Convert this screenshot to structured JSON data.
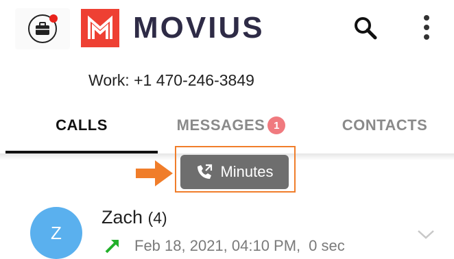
{
  "header": {
    "brand": "MOVIUS",
    "work_button_icon": "briefcase-icon",
    "search_icon": "search-icon",
    "menu_icon": "more-vert-icon",
    "logo_colors": {
      "mark": "#ee4033",
      "text": "#2e2b46"
    },
    "notification_dot_color": "#e8221b"
  },
  "work_line": {
    "label": "Work:",
    "number": "+1 470-246-3849"
  },
  "tabs": [
    {
      "label": "CALLS",
      "active": true
    },
    {
      "label": "MESSAGES",
      "badge": "1",
      "active": false
    },
    {
      "label": "CONTACTS",
      "active": false
    }
  ],
  "minutes": {
    "label": "Minutes",
    "icon": "phone-transfer-icon",
    "highlight_color": "#f07d2a",
    "arrow_icon": "arrow-right-icon"
  },
  "calls": [
    {
      "initial": "Z",
      "name": "Zach",
      "count": "(4)",
      "direction_icon": "outgoing-call-arrow-icon",
      "datetime": "Feb 18, 2021, 04:10 PM,",
      "duration": "0 sec",
      "avatar_color": "#5ab0ee"
    }
  ]
}
